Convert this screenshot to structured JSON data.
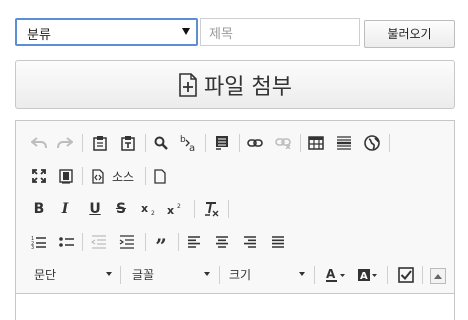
{
  "form": {
    "category_selected": "분류",
    "title_placeholder": "제목",
    "load_label": "불러오기",
    "attach_label": "파일 첨부"
  },
  "editor": {
    "source_label": "소스",
    "format_label": "문단",
    "font_label": "글꼴",
    "size_label": "크기"
  }
}
